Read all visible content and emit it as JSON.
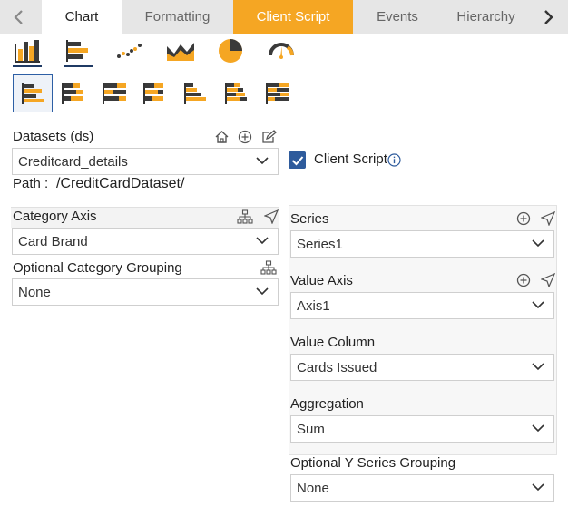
{
  "tabs": [
    {
      "label": "Chart"
    },
    {
      "label": "Formatting"
    },
    {
      "label": "Client Script"
    },
    {
      "label": "Events"
    },
    {
      "label": "Hierarchy"
    }
  ],
  "datasets": {
    "label": "Datasets (ds)",
    "value": "Creditcard_details",
    "path_label": "Path :",
    "path_value": "/CreditCardDataset/"
  },
  "client_script": {
    "label": "Client Script",
    "checked": true
  },
  "category_axis": {
    "label": "Category Axis",
    "value": "Card Brand"
  },
  "optional_category_grouping": {
    "label": "Optional Category Grouping",
    "value": "None"
  },
  "series": {
    "label": "Series",
    "value": "Series1"
  },
  "value_axis": {
    "label": "Value Axis",
    "value": "Axis1"
  },
  "value_column": {
    "label": "Value Column",
    "value": "Cards Issued"
  },
  "aggregation": {
    "label": "Aggregation",
    "value": "Sum"
  },
  "optional_y_series_grouping": {
    "label": "Optional Y Series Grouping",
    "value": "None"
  },
  "colors": {
    "accent": "#f5a623",
    "dark": "#3a3a3a",
    "brand_blue": "#2e5b9c"
  },
  "chart_types": [
    "column-chart-icon",
    "bar-chart-icon",
    "scatter-chart-icon",
    "area-chart-icon",
    "pie-chart-icon",
    "gauge-chart-icon"
  ]
}
